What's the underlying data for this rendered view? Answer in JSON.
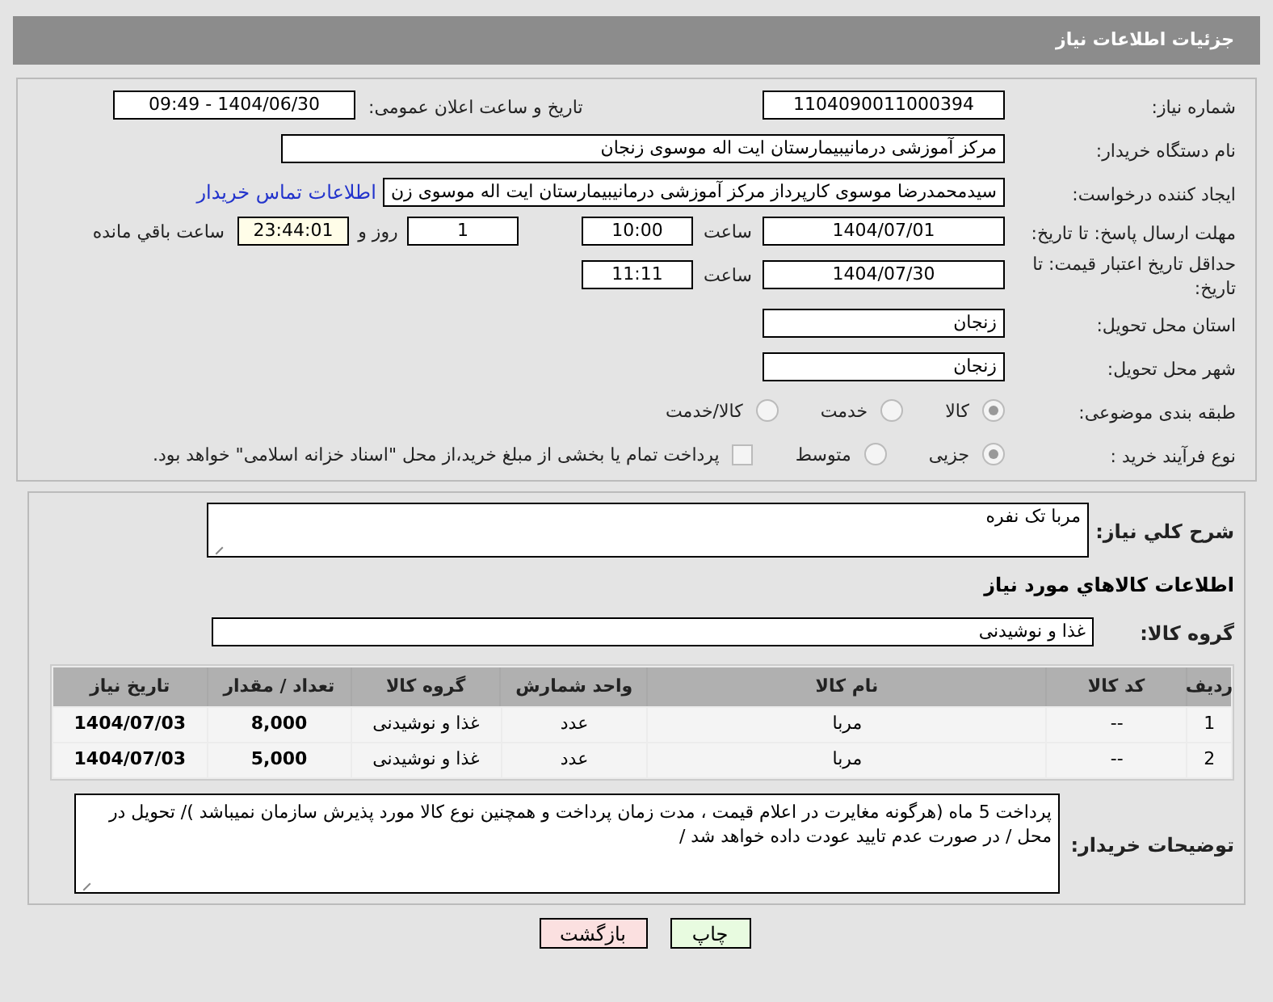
{
  "header": {
    "title": "جزئیات اطلاعات نیاز"
  },
  "need_number": {
    "label": "شماره نیاز:",
    "value": "1104090011000394"
  },
  "announce": {
    "label": "تاریخ و ساعت اعلان عمومی:",
    "value": "1404/06/30 - 09:49"
  },
  "buyer_org": {
    "label": "نام دستگاه خریدار:",
    "value": "مرکز آموزشی درمانیبیمارستان ایت اله موسوی زنجان"
  },
  "requester": {
    "label": "ایجاد کننده درخواست:",
    "value": "سیدمحمدرضا موسوی کارپرداز مرکز آموزشی درمانیبیمارستان ایت اله موسوی زن",
    "link": "اطلاعات تماس خریدار"
  },
  "deadline": {
    "label": "مهلت ارسال پاسخ: تا تاریخ:",
    "date": "1404/07/01",
    "time_label": "ساعت",
    "time": "10:00",
    "days": "1",
    "days_label": "روز و",
    "remaining": "23:44:01",
    "remaining_label": "ساعت باقي مانده"
  },
  "validity": {
    "label": "حداقل تاریخ اعتبار قیمت: تا تاریخ:",
    "date": "1404/07/30",
    "time_label": "ساعت",
    "time": "11:11"
  },
  "province": {
    "label": "استان محل تحویل:",
    "value": "زنجان"
  },
  "city": {
    "label": "شهر محل تحویل:",
    "value": "زنجان"
  },
  "category": {
    "label": "طبقه بندی موضوعی:",
    "options": [
      {
        "label": "کالا",
        "selected": true
      },
      {
        "label": "خدمت",
        "selected": false
      },
      {
        "label": "کالا/خدمت",
        "selected": false
      }
    ]
  },
  "process": {
    "label": "نوع فرآیند خرید :",
    "options": [
      {
        "label": "جزیی",
        "selected": true
      },
      {
        "label": "متوسط",
        "selected": false
      }
    ],
    "payment": {
      "checked": false,
      "text": "پرداخت تمام یا بخشی از مبلغ خرید،از محل \"اسناد خزانه اسلامی\" خواهد بود."
    }
  },
  "description": {
    "label": "شرح کلي نياز:",
    "value": "مربا تک نفره"
  },
  "goods_heading": "اطلاعات کالاهاي مورد نياز",
  "goods_group": {
    "label": "گروه کالا:",
    "value": "غذا و نوشیدنی"
  },
  "table": {
    "columns": [
      "ردیف",
      "کد کالا",
      "نام کالا",
      "واحد شمارش",
      "گروه کالا",
      "تعداد / مقدار",
      "تاریخ نیاز"
    ],
    "rows": [
      [
        "1",
        "--",
        "مربا",
        "عدد",
        "غذا و نوشیدنی",
        "8,000",
        "1404/07/03"
      ],
      [
        "2",
        "--",
        "مربا",
        "عدد",
        "غذا و نوشیدنی",
        "5,000",
        "1404/07/03"
      ]
    ]
  },
  "notes": {
    "label": "توضیحات خریدار:",
    "value": "پرداخت 5 ماه (هرگونه مغایرت در اعلام قیمت ، مدت زمان پرداخت و همچنین نوع کالا مورد پذیرش سازمان نمیباشد )/ تحویل در محل / در صورت عدم تایید عودت داده خواهد شد /"
  },
  "buttons": [
    {
      "label": "چاپ",
      "kind": "print"
    },
    {
      "label": "بازگشت",
      "kind": "back"
    }
  ]
}
